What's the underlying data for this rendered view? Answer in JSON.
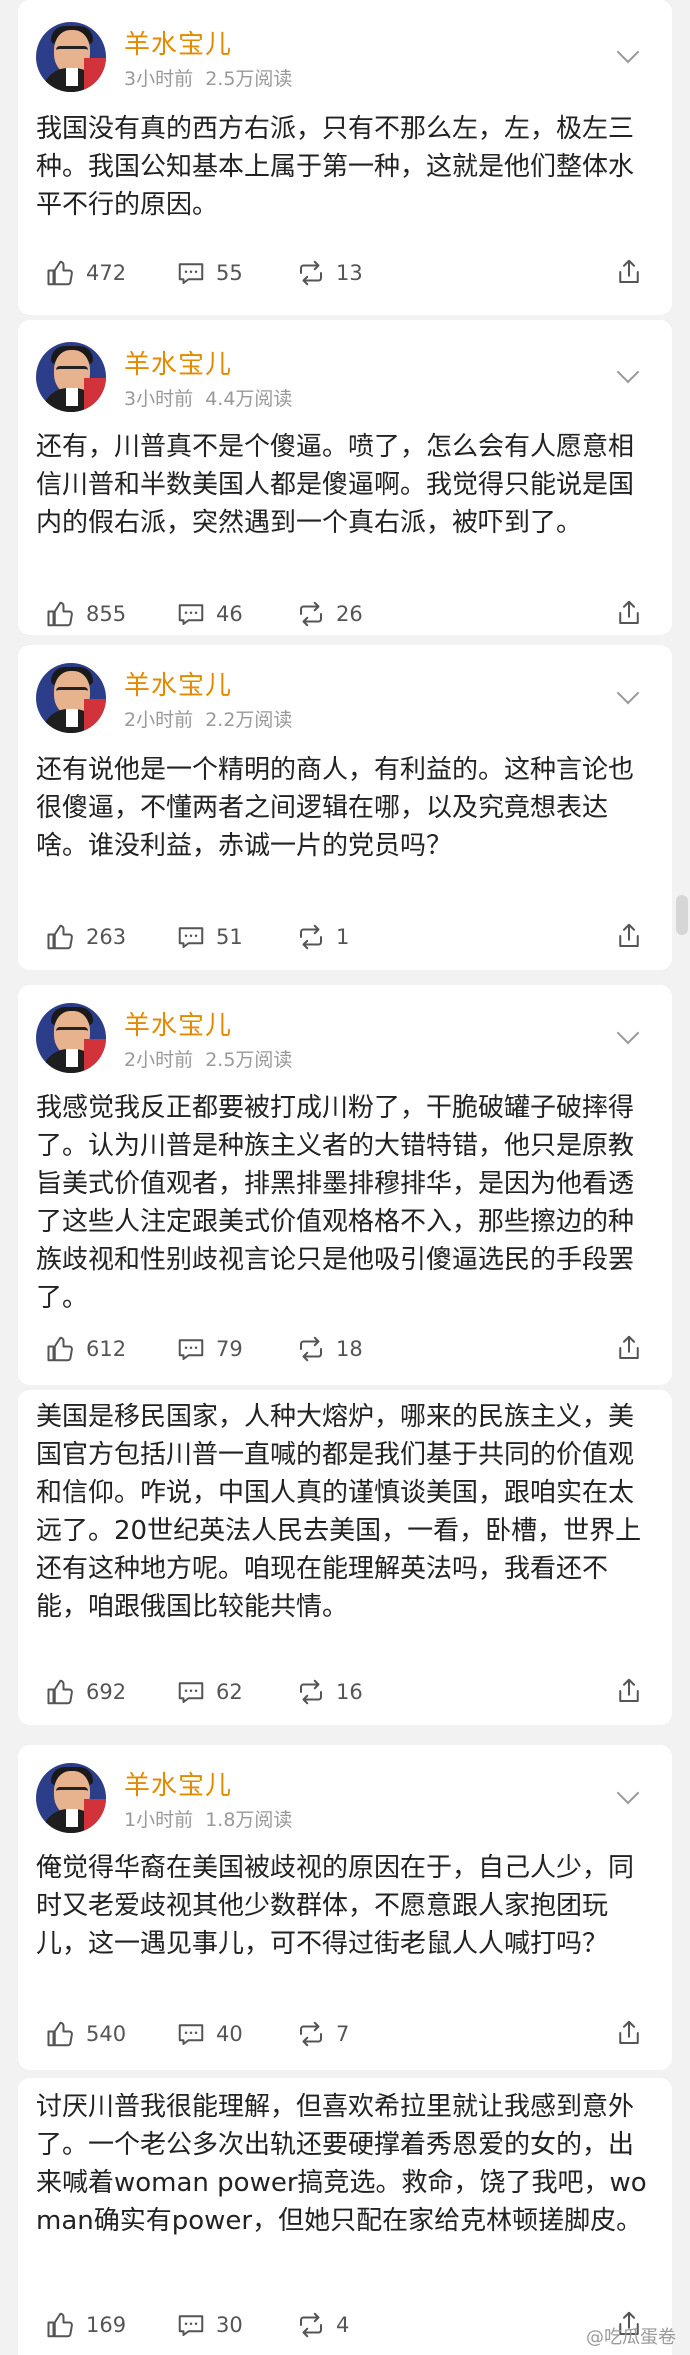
{
  "posts": [
    {
      "author": "羊水宝儿",
      "time": "3小时前",
      "reads": "2.5万阅读",
      "text": "我国没有真的西方右派，只有不那么左，左，极左三种。我国公知基本上属于第一种，这就是他们整体水平不行的原因。",
      "likes": "472",
      "comments": "55",
      "reposts": "13"
    },
    {
      "author": "羊水宝儿",
      "time": "3小时前",
      "reads": "4.4万阅读",
      "text": "还有，川普真不是个傻逼。喷了，怎么会有人愿意相信川普和半数美国人都是傻逼啊。我觉得只能说是国内的假右派，突然遇到一个真右派，被吓到了。",
      "likes": "855",
      "comments": "46",
      "reposts": "26"
    },
    {
      "author": "羊水宝儿",
      "time": "2小时前",
      "reads": "2.2万阅读",
      "text": "还有说他是一个精明的商人，有利益的。这种言论也很傻逼，不懂两者之间逻辑在哪，以及究竟想表达啥。谁没利益，赤诚一片的党员吗？",
      "likes": "263",
      "comments": "51",
      "reposts": "1"
    },
    {
      "author": "羊水宝儿",
      "time": "2小时前",
      "reads": "2.5万阅读",
      "text": "我感觉我反正都要被打成川粉了，干脆破罐子破摔得了。认为川普是种族主义者的大错特错，他只是原教旨美式价值观者，排黑排墨排穆排华，是因为他看透了这些人注定跟美式价值观格格不入，那些擦边的种族歧视和性别歧视言论只是他吸引傻逼选民的手段罢了。",
      "likes": "612",
      "comments": "79",
      "reposts": "18"
    },
    {
      "text": "美国是移民国家，人种大熔炉，哪来的民族主义，美国官方包括川普一直喊的都是我们基于共同的价值观和信仰。咋说，中国人真的谨慎谈美国，跟咱实在太远了。20世纪英法人民去美国，一看，卧槽，世界上还有这种地方呢。咱现在能理解英法吗，我看还不能，咱跟俄国比较能共情。",
      "likes": "692",
      "comments": "62",
      "reposts": "16"
    },
    {
      "author": "羊水宝儿",
      "time": "1小时前",
      "reads": "1.8万阅读",
      "text": "俺觉得华裔在美国被歧视的原因在于，自己人少，同时又老爱歧视其他少数群体，不愿意跟人家抱团玩儿，这一遇见事儿，可不得过街老鼠人人喊打吗？",
      "likes": "540",
      "comments": "40",
      "reposts": "7"
    },
    {
      "text": "讨厌川普我很能理解，但喜欢希拉里就让我感到意外了。一个老公多次出轨还要硬撑着秀恩爱的女的，出来喊着woman power搞竞选。救命，饶了我吧，woman确实有power，但她只配在家给克林顿搓脚皮。",
      "likes": "169",
      "comments": "30",
      "reposts": "4"
    }
  ],
  "watermark": "@吃瓜蛋卷",
  "colors": {
    "author": "#e28b00",
    "meta": "#999999",
    "text": "#222222",
    "background": "#f2f2f2"
  },
  "icons": [
    "like-icon",
    "comment-icon",
    "repost-icon",
    "share-icon",
    "chevron-down-icon"
  ]
}
